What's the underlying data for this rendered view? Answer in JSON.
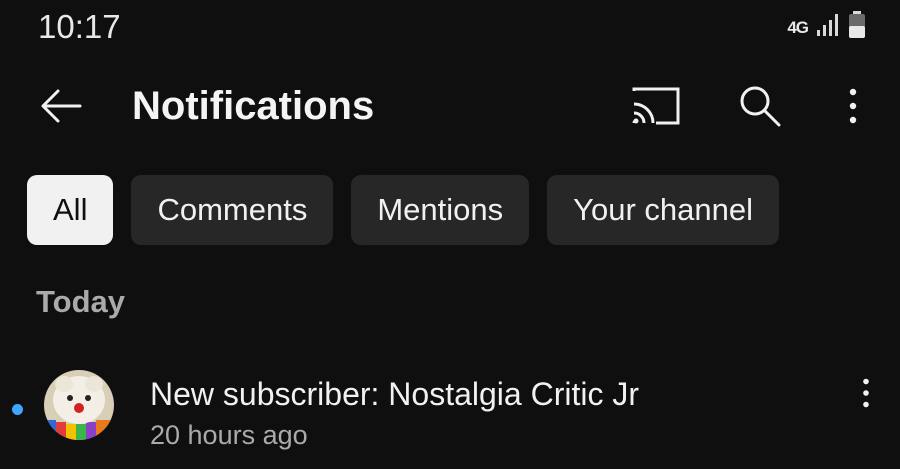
{
  "status_bar": {
    "time": "10:17",
    "network_label": "4G",
    "icons": [
      "lte-icon",
      "signal-icon",
      "battery-icon"
    ]
  },
  "app_bar": {
    "title": "Notifications",
    "icons": [
      "back-arrow-icon",
      "cast-icon",
      "search-icon",
      "more-vertical-icon"
    ]
  },
  "chips": [
    {
      "label": "All",
      "selected": true
    },
    {
      "label": "Comments",
      "selected": false
    },
    {
      "label": "Mentions",
      "selected": false
    },
    {
      "label": "Your channel",
      "selected": false
    }
  ],
  "sections": [
    {
      "header": "Today",
      "items": [
        {
          "text": "New subscriber: Nostalgia Critic Jr",
          "time": "20 hours ago",
          "unread": true
        }
      ]
    }
  ],
  "colors": {
    "background": "#0f0f0f",
    "chip_background": "#272727",
    "chip_selected_background": "#f1f1f1",
    "unread_dot": "#3ea6ff",
    "secondary_text": "#aaaaaa"
  }
}
